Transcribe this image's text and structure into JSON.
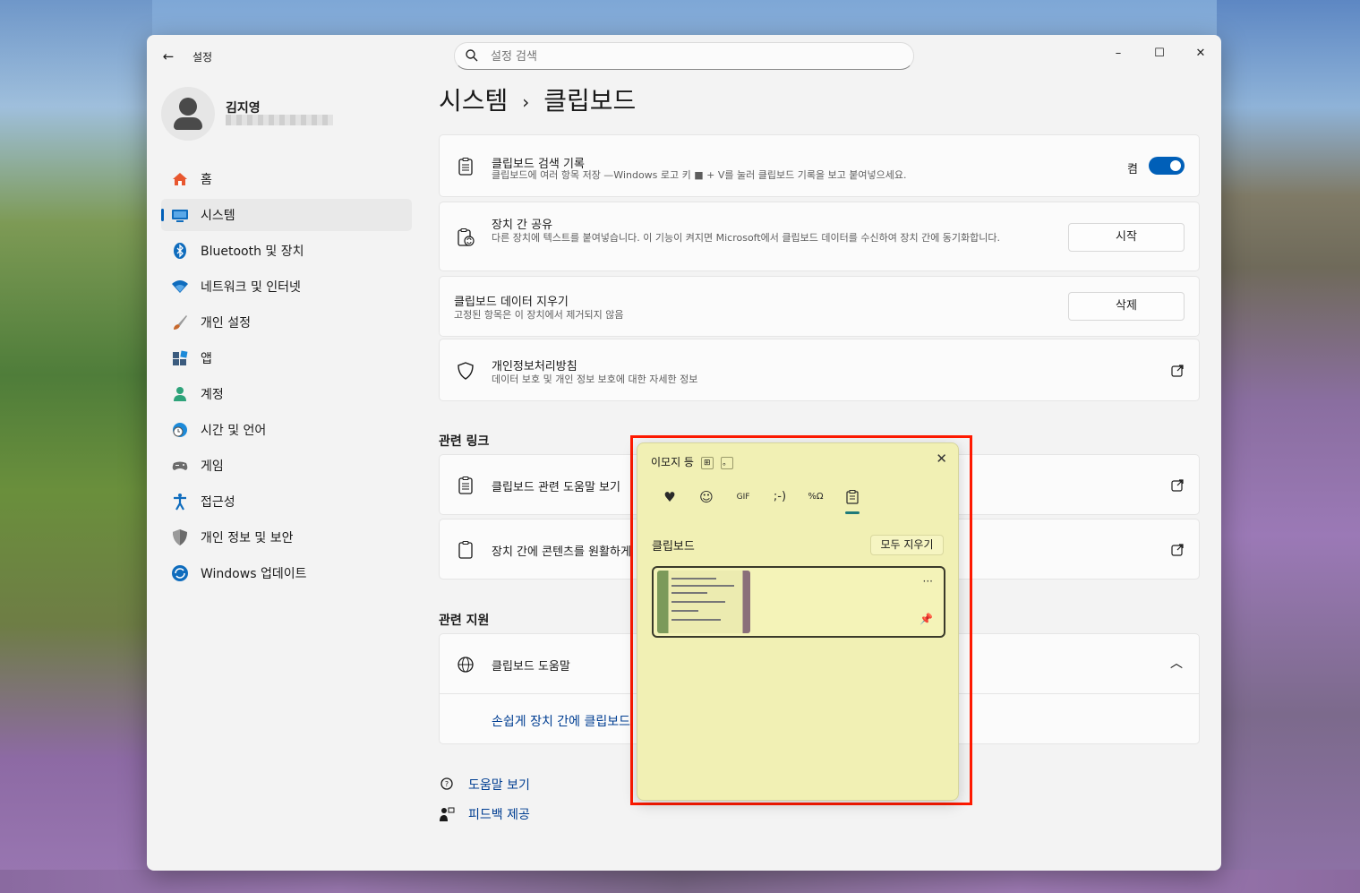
{
  "window": {
    "app_title": "설정",
    "controls": {
      "minimize": "–",
      "maximize": "☐",
      "close": "✕"
    }
  },
  "search": {
    "placeholder": "설정 검색"
  },
  "profile": {
    "name": "김지영"
  },
  "nav": {
    "items": [
      {
        "label": "홈",
        "icon": "home-icon",
        "color": "#e8572f"
      },
      {
        "label": "시스템",
        "icon": "system-icon",
        "color": "#0f6cbd",
        "active": true
      },
      {
        "label": "Bluetooth 및 장치",
        "icon": "bluetooth-icon",
        "color": "#0f6cbd"
      },
      {
        "label": "네트워크 및 인터넷",
        "icon": "wifi-icon",
        "color": "#0f6cbd"
      },
      {
        "label": "개인 설정",
        "icon": "brush-icon",
        "color": "#c7682c"
      },
      {
        "label": "앱",
        "icon": "apps-icon",
        "color": "#3b5b7e"
      },
      {
        "label": "계정",
        "icon": "account-icon",
        "color": "#2ea37a"
      },
      {
        "label": "시간 및 언어",
        "icon": "globe-clock-icon",
        "color": "#1c8ad9"
      },
      {
        "label": "게임",
        "icon": "gamepad-icon",
        "color": "#6b6b6b"
      },
      {
        "label": "접근성",
        "icon": "accessibility-icon",
        "color": "#0f6cbd"
      },
      {
        "label": "개인 정보 및 보안",
        "icon": "shield-icon",
        "color": "#6b6b6b"
      },
      {
        "label": "Windows 업데이트",
        "icon": "update-icon",
        "color": "#0f6cbd"
      }
    ]
  },
  "page": {
    "breadcrumb_parent": "시스템",
    "breadcrumb_sep": "›",
    "title": "클립보드"
  },
  "cards": {
    "history": {
      "title": "클립보드 검색 기록",
      "desc": "클립보드에 여러 항목 저장 —Windows 로고 키 ■ + V를 눌러 클립보드 기록을 보고 붙여넣으세요.",
      "toggle_label": "켬",
      "toggle_on": true
    },
    "share": {
      "title": "장치 간 공유",
      "desc": "다른 장치에 텍스트를 붙여넣습니다. 이 기능이 켜지면 Microsoft에서 클립보드 데이터를 수신하여 장치 간에 동기화합니다.",
      "button": "시작"
    },
    "clear": {
      "title": "클립보드 데이터 지우기",
      "desc": "고정된 항목은 이 장치에서 제거되지 않음",
      "button": "삭제"
    },
    "privacy": {
      "title": "개인정보처리방침",
      "desc": "데이터 보호 및 개인 정보 보호에 대한 자세한 정보"
    }
  },
  "related_links": {
    "heading": "관련 링크",
    "items": [
      {
        "label": "클립보드 관련 도움말 보기"
      },
      {
        "label": "장치 간에 콘텐츠를 원활하게"
      }
    ]
  },
  "related_support": {
    "heading": "관련 지원",
    "help_title": "클립보드 도움말",
    "help_link": "손쉽게 장치 간에 클립보드"
  },
  "footer": {
    "help": "도움말 보기",
    "feedback": "피드백 제공"
  },
  "emoji_panel": {
    "title": "이모지 등",
    "key_hint": "。",
    "tabs": [
      {
        "label": "♥",
        "icon": "heart-icon"
      },
      {
        "label": "☺",
        "icon": "emoji-icon"
      },
      {
        "label": "GIF",
        "icon": "gif-icon"
      },
      {
        "label": ";-)",
        "icon": "kaomoji-icon"
      },
      {
        "label": "%Ω",
        "icon": "symbols-icon"
      },
      {
        "label": "📋",
        "icon": "clipboard-icon",
        "active": true
      }
    ],
    "heading": "클립보드",
    "clear_all": "모두 지우기",
    "item_more": "···"
  }
}
